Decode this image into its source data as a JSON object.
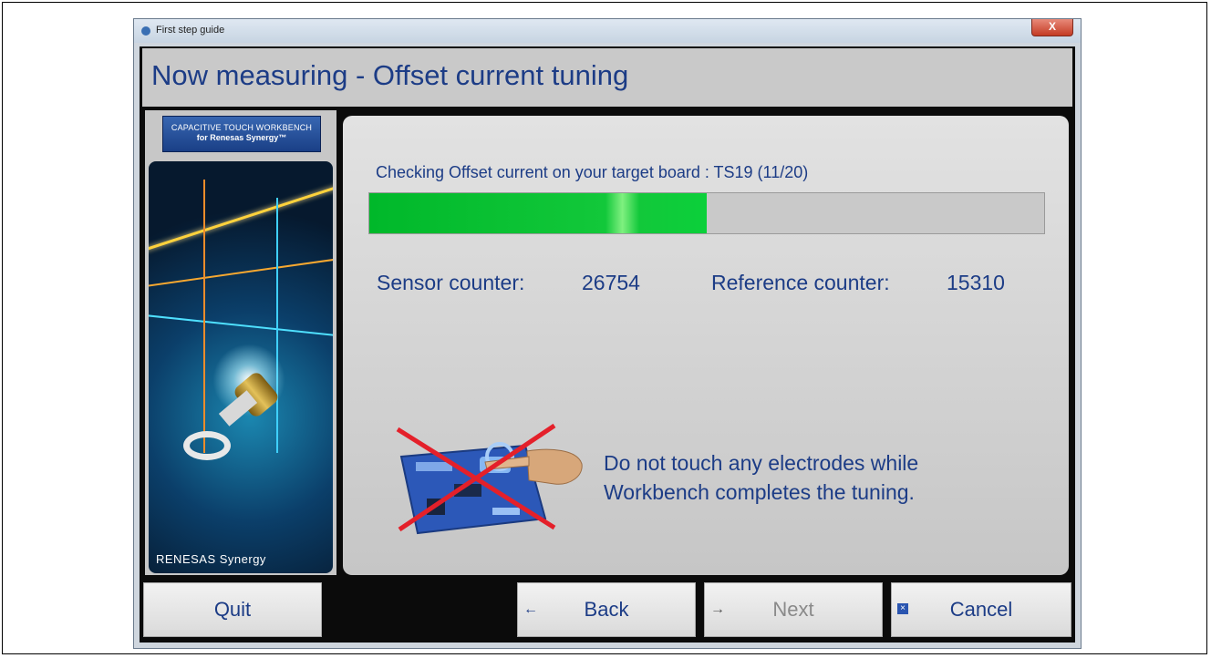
{
  "window": {
    "title": "First step guide",
    "close_label": "X"
  },
  "header": {
    "title": "Now measuring - Offset current tuning"
  },
  "sidebar": {
    "badge_line1": "CAPACITIVE TOUCH WORKBENCH",
    "badge_line2": "for Renesas Synergy™",
    "brand": "RENESAS Synergy"
  },
  "main": {
    "status_text": "Checking Offset current on your target board : TS19 (11/20)",
    "progress": {
      "fraction": 0.5,
      "fill_color": "#00c030"
    },
    "sensor_counter_label": "Sensor counter:",
    "sensor_counter_value": "26754",
    "reference_counter_label": "Reference counter:",
    "reference_counter_value": "15310",
    "warning_line1": "Do not touch any electrodes while",
    "warning_line2": "Workbench completes the tuning."
  },
  "buttons": {
    "quit": "Quit",
    "back": "Back",
    "next": "Next",
    "cancel": "Cancel"
  },
  "colors": {
    "accent_text": "#1c3c86",
    "progress_green": "#00c030",
    "no_touch_red": "#e4202a"
  }
}
